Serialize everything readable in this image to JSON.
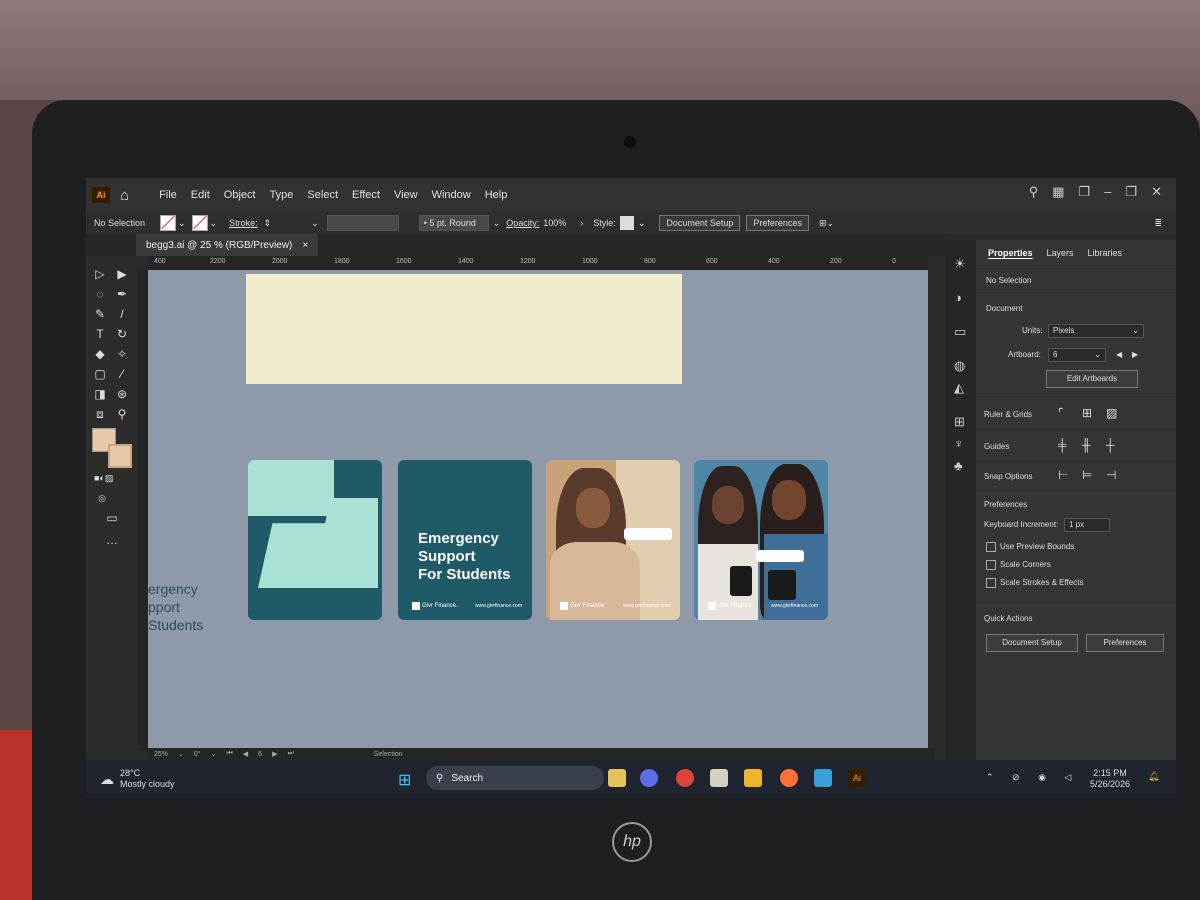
{
  "menubar": {
    "app_badge": "Ai",
    "items": [
      "File",
      "Edit",
      "Object",
      "Type",
      "Select",
      "Effect",
      "View",
      "Window",
      "Help"
    ]
  },
  "control_bar": {
    "selection": "No Selection",
    "stroke_label": "Stroke:",
    "brush": "5 pt. Round",
    "opacity_label": "Opacity:",
    "opacity_value": "100%",
    "style_label": "Style:",
    "document_setup": "Document Setup",
    "preferences": "Preferences"
  },
  "document_tab": {
    "title": "begg3.ai @ 25 % (RGB/Preview)",
    "close": "×"
  },
  "ruler_top": [
    "400",
    "2200",
    "2000",
    "1800",
    "1600",
    "1400",
    "1200",
    "1000",
    "800",
    "600",
    "400",
    "200",
    "0"
  ],
  "canvas": {
    "card2_headline": [
      "Emergency",
      "Support",
      "For Students"
    ],
    "brand": "Givr Finance.",
    "url": "www.givrfinance.com",
    "offboard_text": [
      "ergency",
      "pport",
      "Students"
    ]
  },
  "statusbar": {
    "zoom": "25%",
    "rotation": "0°",
    "artboard": "6",
    "mode": "Selection"
  },
  "panel": {
    "tabs": [
      "Properties",
      "Layers",
      "Libraries"
    ],
    "active_tab": "Properties",
    "no_selection": "No Selection",
    "document_heading": "Document",
    "units_label": "Units:",
    "units_value": "Pixels",
    "artboard_label": "Artboard:",
    "artboard_value": "6",
    "edit_artboards": "Edit Artboards",
    "rulers_grids": "Ruler & Grids",
    "guides": "Guides",
    "snap_options": "Snap Options",
    "preferences_heading": "Preferences",
    "keyboard_increment_label": "Keyboard Increment:",
    "keyboard_increment_value": "1 px",
    "use_preview_bounds": "Use Preview Bounds",
    "scale_corners": "Scale Corners",
    "scale_strokes": "Scale Strokes & Effects",
    "quick_actions": "Quick Actions",
    "qa_document_setup": "Document Setup",
    "qa_preferences": "Preferences"
  },
  "taskbar": {
    "temp": "28°C",
    "weather": "Mostly cloudy",
    "search": "Search",
    "time": "2:15 PM",
    "date": "5/26/2026"
  },
  "laptop_brand": "hp",
  "colors": {
    "accent": "#ff9a00",
    "card_teal": "#1f5a68",
    "card_mint": "#a9e2d4",
    "artboard_cream": "#f2ebcd"
  }
}
